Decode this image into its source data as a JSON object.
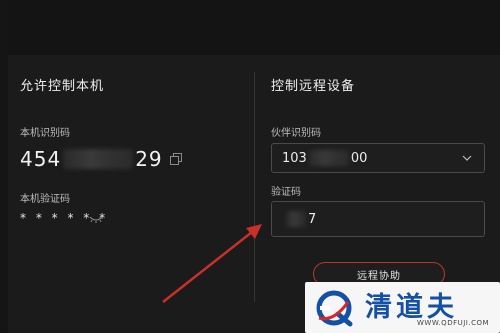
{
  "left_panel": {
    "title": "允许控制本机",
    "id_label": "本机识别码",
    "id_prefix": "454",
    "id_suffix": "29",
    "password_label": "本机验证码",
    "password_value": "* * * * * *"
  },
  "right_panel": {
    "title": "控制远程设备",
    "partner_label": "伙伴识别码",
    "partner_prefix": "103",
    "partner_suffix": "00",
    "verify_label": "验证码",
    "verify_suffix": "7",
    "connect_button": "远程协助"
  },
  "watermark": {
    "title": "清道夫",
    "url": "WWW.QDFUJI.COM"
  },
  "colors": {
    "background": "#1b1b1b",
    "accent_red": "#b23a2e",
    "arrow_red": "#c8302a",
    "watermark_blue": "#1450a3"
  }
}
